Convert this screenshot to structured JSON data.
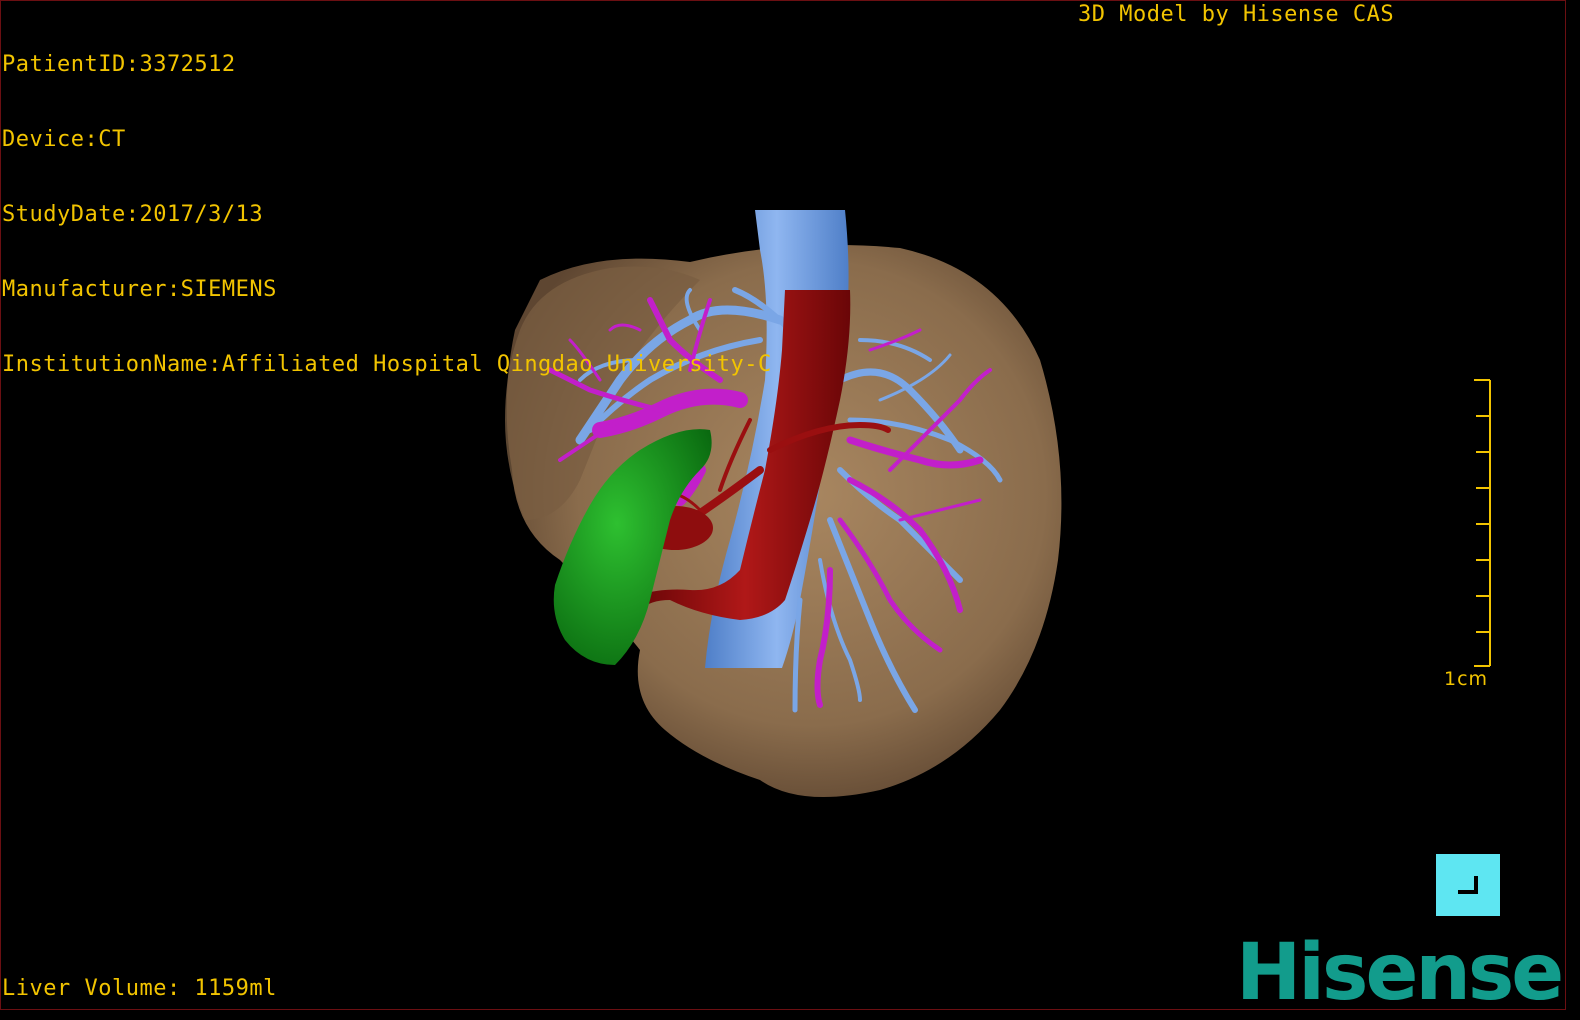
{
  "overlay": {
    "patient_id": "PatientID:3372512",
    "device": "Device:CT",
    "study_date": "StudyDate:2017/3/13",
    "manufacturer": "Manufacturer:SIEMENS",
    "institution": "InstitutionName:Affiliated Hospital Qingdao University-C",
    "credit": "3D Model by Hisense CAS",
    "liver_volume": "Liver Volume: 1159ml"
  },
  "scale_bar": {
    "label": "1cm"
  },
  "brand": {
    "logo_text": "Hisense"
  },
  "colors": {
    "overlay_text": "#f2c400",
    "liver": "#8a6c4c",
    "portal_vein": "#6f9fe0",
    "artery": "#9a0f10",
    "hepatic_vein": "#c01fc8",
    "gallbladder": "#129a1a",
    "corner_button": "#5ee6f2",
    "logo": "#129c8c"
  },
  "icons": {
    "corner_button": "corner-bracket-icon"
  }
}
